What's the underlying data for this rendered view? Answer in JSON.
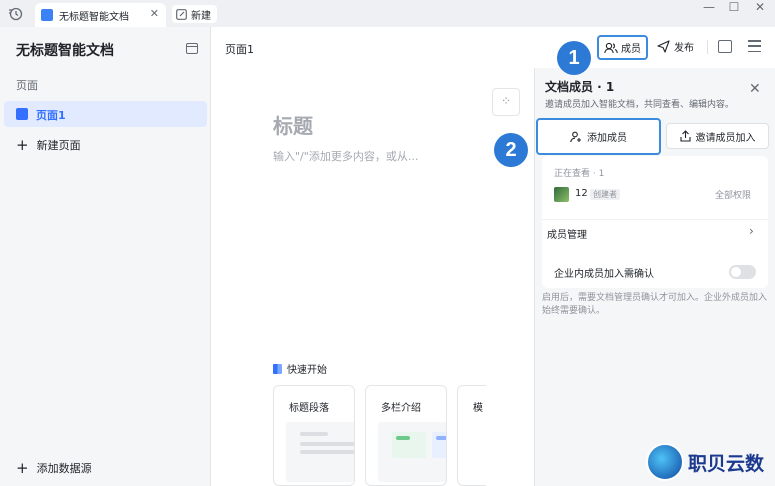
{
  "titlebar": {
    "tab_title": "无标题智能文档",
    "new_label": "新建"
  },
  "sidebar": {
    "doc_title": "无标题智能文档",
    "section_label": "页面",
    "page_item": "页面1",
    "new_page": "新建页面",
    "add_data_source": "添加数据源"
  },
  "main": {
    "breadcrumb": "页面1",
    "heading_placeholder": "标题",
    "body_placeholder": "输入\"/\"添加更多内容，或从...",
    "quick_start": "快速开始",
    "templates": [
      "标题段落",
      "多栏介绍",
      "模"
    ]
  },
  "toolbar": {
    "members_label": "成员",
    "publish_label": "发布"
  },
  "members_panel": {
    "title": "文档成员 · 1",
    "subtitle": "邀请成员加入智能文档，共同查看、编辑内容。",
    "add_member": "添加成员",
    "invite_member": "邀请成员加入",
    "viewing": "正在查看 · 1",
    "user_name": "12",
    "creator_badge": "创建者",
    "permission": "全部权限",
    "manage": "成员管理",
    "confirm_label": "企业内成员加入需确认",
    "confirm_desc": "启用后，需要文档管理员确认才可加入。企业外成员加入始终需要确认。"
  },
  "steps": [
    "1",
    "2"
  ],
  "watermark": {
    "text": "职贝云数"
  },
  "colors": {
    "accent": "#3370ff",
    "highlight": "#3b8bde",
    "step_badge": "#2d7ad6"
  }
}
